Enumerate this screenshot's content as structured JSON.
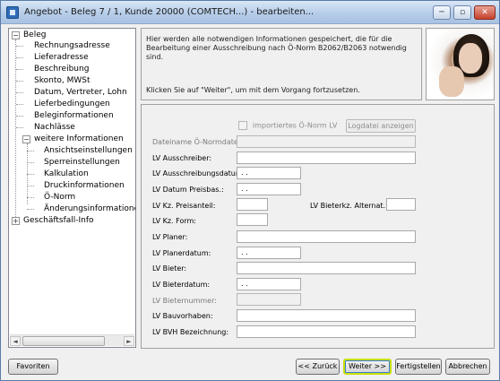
{
  "window": {
    "title": "Angebot - Beleg 7 / 1, Kunde 20000 (COMTECH...) - bearbeiten...",
    "min_label": "─",
    "max_label": "▫",
    "close_label": "✕"
  },
  "tree": {
    "root_label": "Beleg",
    "root_toggle": "−",
    "items": [
      "Rechnungsadresse",
      "Lieferadresse",
      "Beschreibung",
      "Skonto, MWSt",
      "Datum, Vertreter, Lohn",
      "Lieferbedingungen",
      "Beleginformationen",
      "Nachlässe"
    ],
    "sub_label": "weitere Informationen",
    "sub_toggle": "−",
    "sub_items": [
      "Ansichtseinstellungen",
      "Sperreinstellungen",
      "Kalkulation",
      "Druckinformationen",
      "Ö-Norm",
      "Änderungsinformationen"
    ],
    "last_label": "Geschäftsfall-Info",
    "last_toggle": "+",
    "scroll_left": "◄",
    "scroll_right": "►"
  },
  "info": {
    "text": "Hier werden alle notwendigen Informationen gespeichert, die für die Bearbeitung einer Ausschreibung nach Ö-Norm B2062/B2063 notwendig sind.",
    "hint": "Klicken Sie auf \"Weiter\", um mit dem Vorgang fortzusetzen."
  },
  "form": {
    "import_checkbox_label": "importiertes Ö-Norm LV",
    "log_button": "Logdatei anzeigen",
    "labels": {
      "dateiname": "Dateiname Ö-Normdatei:",
      "ausschreiber": "LV Ausschreiber:",
      "ausschreibungsdatum": "LV Ausschreibungsdatum:",
      "datum_preisbasis": "LV Datum Preisbas.:",
      "preisanteil": "LV Kz. Preisanteil:",
      "bieterkz": "LV Bieterkz. Alternat.:",
      "form": "LV Kz. Form:",
      "planer": "LV Planer:",
      "planerdatum": "LV Planerdatum:",
      "bieter": "LV Bieter:",
      "bieterdatum": "LV Bieterdatum:",
      "bieternummer": "LV Bieternummer:",
      "bauvorhaben": "LV Bauvorhaben:",
      "bvh": "LV BVH Bezeichnung:"
    },
    "values": {
      "dateiname": "",
      "ausschreiber": "",
      "ausschreibungsdatum": ". .",
      "datum_preisbasis": ". .",
      "preisanteil": "",
      "bieterkz": "",
      "form": "",
      "planer": "",
      "planerdatum": ". .",
      "bieter": "",
      "bieterdatum": ". .",
      "bieternummer": "",
      "bauvorhaben": "",
      "bvh": ""
    }
  },
  "buttons": {
    "favoriten": "Favoriten",
    "zurueck": "<< Zurück",
    "weiter": "Weiter >>",
    "fertigstellen": "Fertigstellen",
    "abbrechen": "Abbrechen"
  }
}
